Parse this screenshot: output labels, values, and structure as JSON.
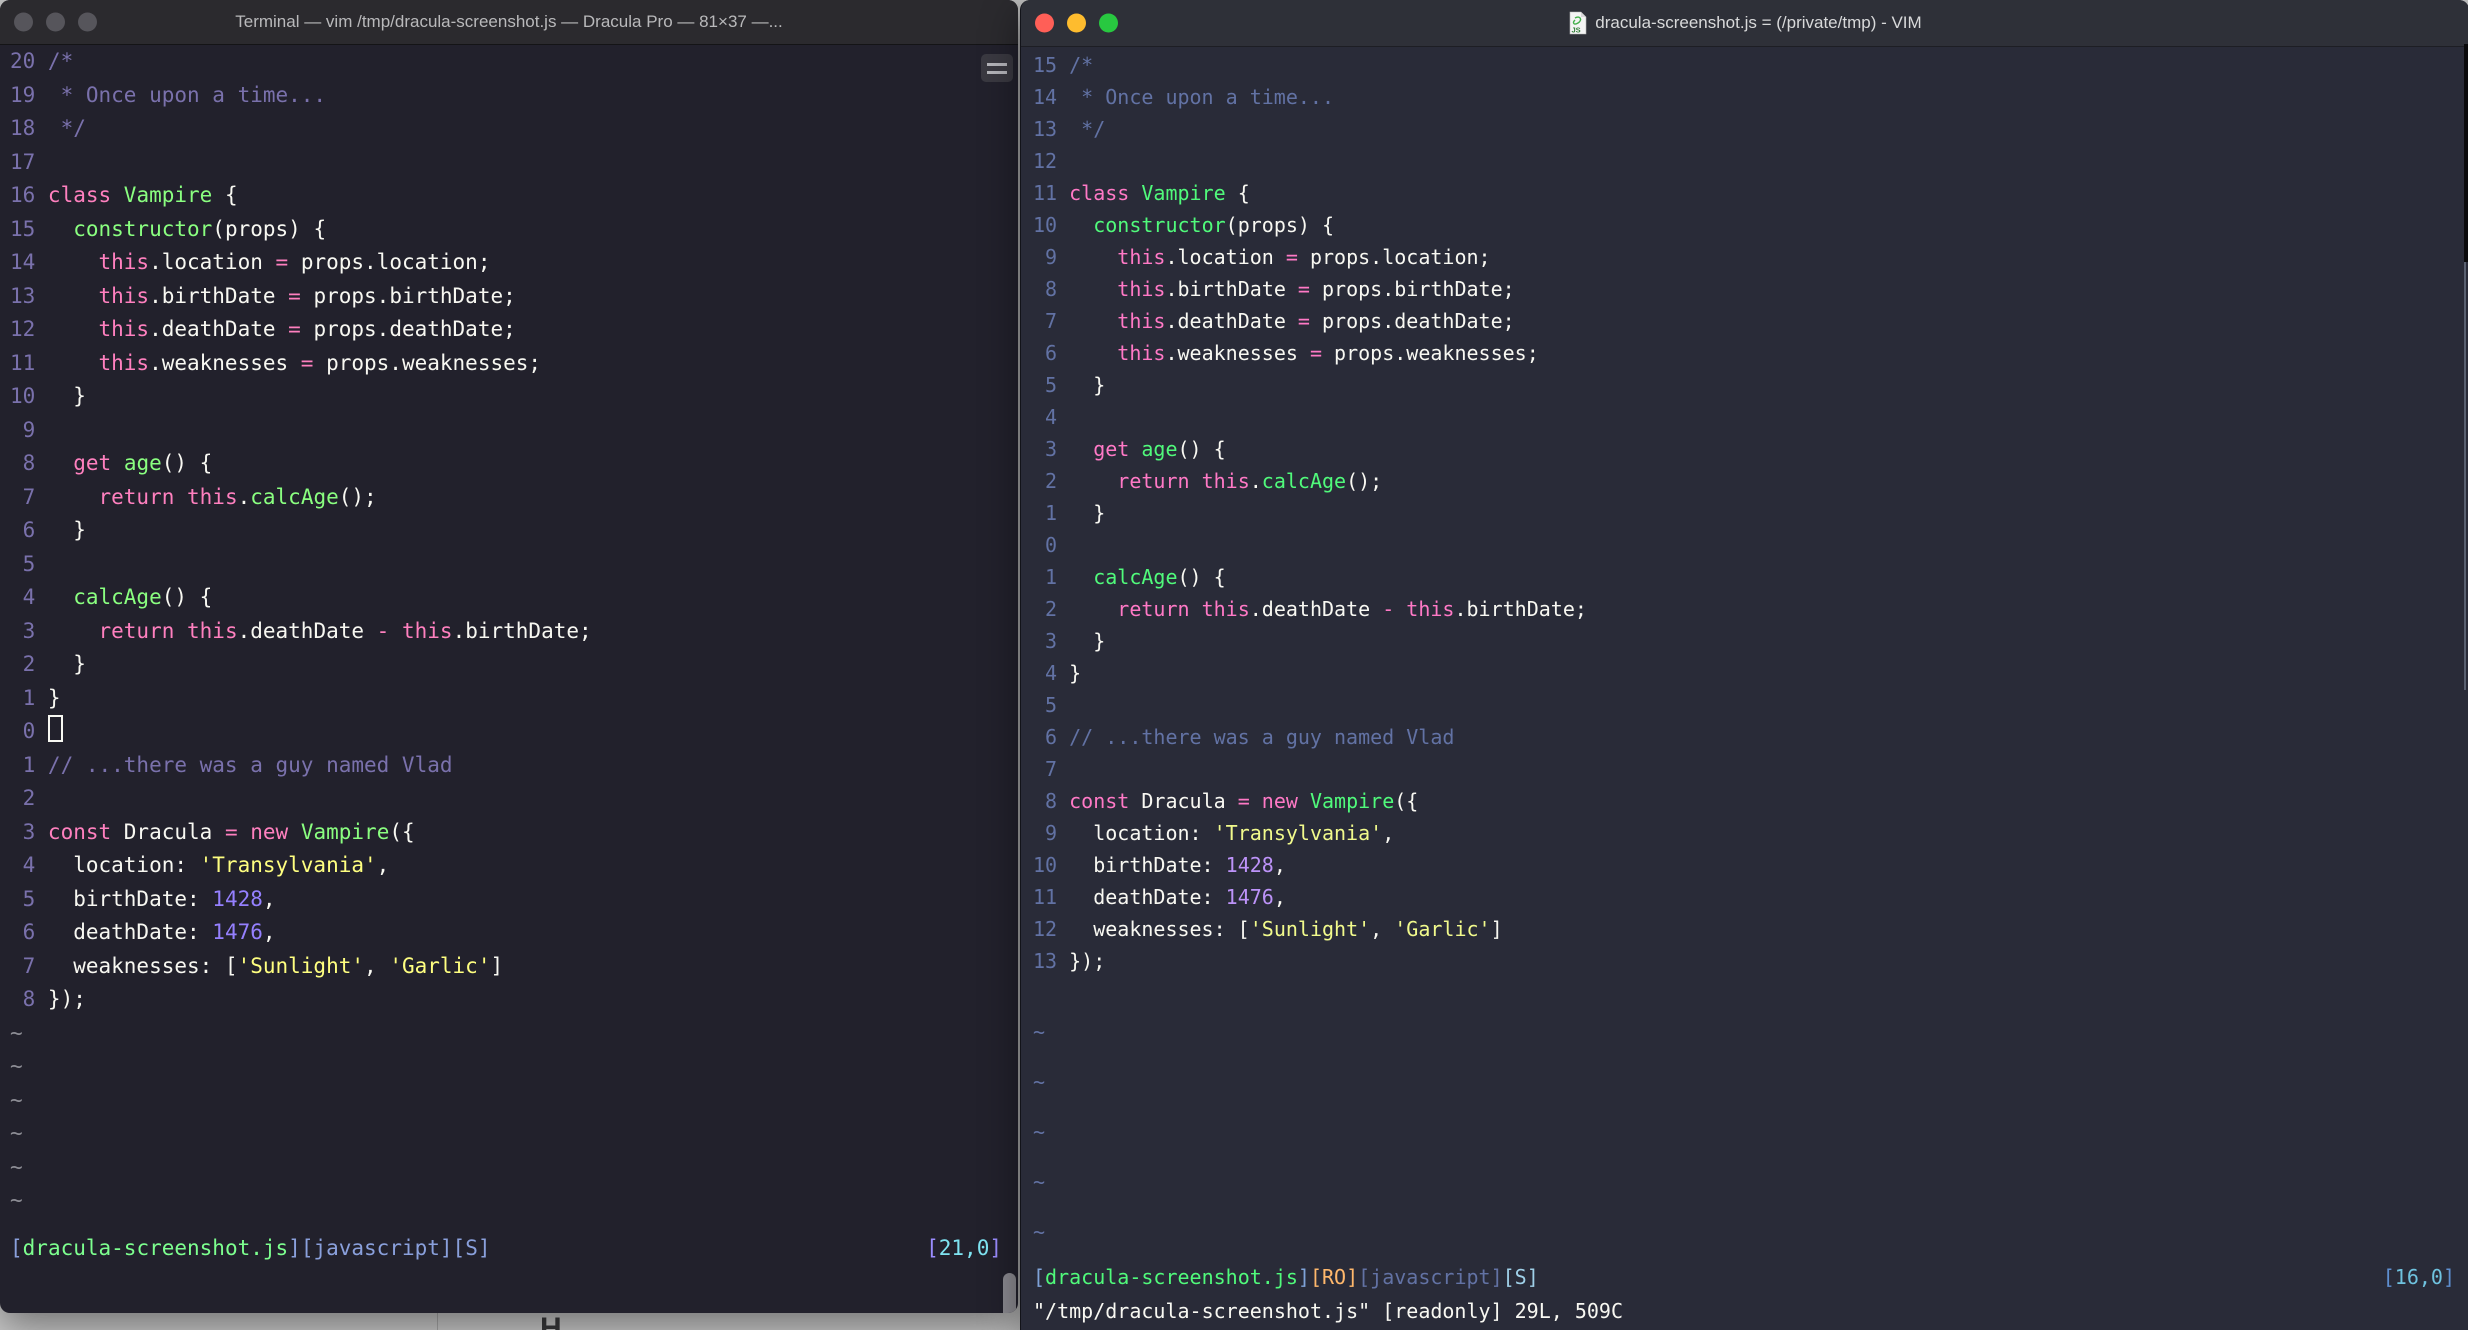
{
  "themes": {
    "left": {
      "bg": "#22212C",
      "titlebar": "#2b2a2e",
      "titlefg": "#b9b9bb",
      "fg": "#F8F8F2",
      "comment": "#7A71AC",
      "keyword": "#FF80BF",
      "func": "#8AFF80",
      "string": "#FFFF80",
      "number": "#9580FF",
      "linenr": "#7A71AC",
      "tilde": "#8d8d95",
      "stBr": "#8aa0dc",
      "stFn": "#7dff8f",
      "stTag": "#8aa0dc",
      "stPosBr": "#9b8cff",
      "stPosNum": "#7fe4f2",
      "trafficInactive": "#56555b"
    },
    "right": {
      "bg": "#292b38",
      "titlebar": "#2e3038",
      "titlefg": "#d8d9da",
      "fg": "#F8F8F2",
      "comment": "#6272A4",
      "keyword": "#FF79C6",
      "func": "#50FA7B",
      "string": "#F1FA8C",
      "number": "#BD93F9",
      "linenr": "#6272A4",
      "tilde": "#6272A4",
      "stBr": "#7fa3d8",
      "stFn": "#50FA7B",
      "stRo": "#FFB86C",
      "stTag": "#6272A4",
      "stS": "#9fd0e8",
      "stPosBr": "#5e8fd0",
      "stPosNum": "#6fc3df",
      "trafficRed": "#FF5F57",
      "trafficYellow": "#FEBC2E",
      "trafficGreen": "#28C840"
    }
  },
  "left_window": {
    "title": "Terminal — vim /tmp/dracula-screenshot.js — Dracula Pro — 81×37 —...",
    "code_lines": [
      {
        "num": "20",
        "segs": [
          [
            "c",
            "/*"
          ]
        ]
      },
      {
        "num": "19",
        "segs": [
          [
            "c",
            " * Once upon a time..."
          ]
        ]
      },
      {
        "num": "18",
        "segs": [
          [
            "c",
            " */"
          ]
        ]
      },
      {
        "num": "17",
        "segs": []
      },
      {
        "num": "16",
        "segs": [
          [
            "k",
            "class"
          ],
          [
            "p",
            " "
          ],
          [
            "f",
            "Vampire"
          ],
          [
            "p",
            " {"
          ]
        ]
      },
      {
        "num": "15",
        "segs": [
          [
            "p",
            "  "
          ],
          [
            "f",
            "constructor"
          ],
          [
            "p",
            "(props) {"
          ]
        ]
      },
      {
        "num": "14",
        "segs": [
          [
            "p",
            "    "
          ],
          [
            "k",
            "this"
          ],
          [
            "p",
            ".location "
          ],
          [
            "k",
            "="
          ],
          [
            "p",
            " props.location;"
          ]
        ]
      },
      {
        "num": "13",
        "segs": [
          [
            "p",
            "    "
          ],
          [
            "k",
            "this"
          ],
          [
            "p",
            ".birthDate "
          ],
          [
            "k",
            "="
          ],
          [
            "p",
            " props.birthDate;"
          ]
        ]
      },
      {
        "num": "12",
        "segs": [
          [
            "p",
            "    "
          ],
          [
            "k",
            "this"
          ],
          [
            "p",
            ".deathDate "
          ],
          [
            "k",
            "="
          ],
          [
            "p",
            " props.deathDate;"
          ]
        ]
      },
      {
        "num": "11",
        "segs": [
          [
            "p",
            "    "
          ],
          [
            "k",
            "this"
          ],
          [
            "p",
            ".weaknesses "
          ],
          [
            "k",
            "="
          ],
          [
            "p",
            " props.weaknesses;"
          ]
        ]
      },
      {
        "num": "10",
        "segs": [
          [
            "p",
            "  }"
          ]
        ]
      },
      {
        "num": "9",
        "segs": []
      },
      {
        "num": "8",
        "segs": [
          [
            "p",
            "  "
          ],
          [
            "k",
            "get"
          ],
          [
            "p",
            " "
          ],
          [
            "f",
            "age"
          ],
          [
            "p",
            "() {"
          ]
        ]
      },
      {
        "num": "7",
        "segs": [
          [
            "p",
            "    "
          ],
          [
            "k",
            "return"
          ],
          [
            "p",
            " "
          ],
          [
            "k",
            "this"
          ],
          [
            "p",
            "."
          ],
          [
            "f",
            "calcAge"
          ],
          [
            "p",
            "();"
          ]
        ]
      },
      {
        "num": "6",
        "segs": [
          [
            "p",
            "  }"
          ]
        ]
      },
      {
        "num": "5",
        "segs": []
      },
      {
        "num": "4",
        "segs": [
          [
            "p",
            "  "
          ],
          [
            "f",
            "calcAge"
          ],
          [
            "p",
            "() {"
          ]
        ]
      },
      {
        "num": "3",
        "segs": [
          [
            "p",
            "    "
          ],
          [
            "k",
            "return"
          ],
          [
            "p",
            " "
          ],
          [
            "k",
            "this"
          ],
          [
            "p",
            ".deathDate "
          ],
          [
            "k",
            "-"
          ],
          [
            "p",
            " "
          ],
          [
            "k",
            "this"
          ],
          [
            "p",
            ".birthDate;"
          ]
        ]
      },
      {
        "num": "2",
        "segs": [
          [
            "p",
            "  }"
          ]
        ]
      },
      {
        "num": "1",
        "segs": [
          [
            "p",
            "}"
          ]
        ]
      },
      {
        "num": "0",
        "segs": [],
        "cursor": true
      },
      {
        "num": "1",
        "segs": [
          [
            "c",
            "// ...there was a guy named Vlad"
          ]
        ]
      },
      {
        "num": "2",
        "segs": []
      },
      {
        "num": "3",
        "segs": [
          [
            "k",
            "const"
          ],
          [
            "p",
            " Dracula "
          ],
          [
            "k",
            "="
          ],
          [
            "p",
            " "
          ],
          [
            "k",
            "new"
          ],
          [
            "p",
            " "
          ],
          [
            "f",
            "Vampire"
          ],
          [
            "p",
            "({"
          ]
        ]
      },
      {
        "num": "4",
        "segs": [
          [
            "p",
            "  location: "
          ],
          [
            "s",
            "'Transylvania'"
          ],
          [
            "p",
            ","
          ]
        ]
      },
      {
        "num": "5",
        "segs": [
          [
            "p",
            "  birthDate: "
          ],
          [
            "n",
            "1428"
          ],
          [
            "p",
            ","
          ]
        ]
      },
      {
        "num": "6",
        "segs": [
          [
            "p",
            "  deathDate: "
          ],
          [
            "n",
            "1476"
          ],
          [
            "p",
            ","
          ]
        ]
      },
      {
        "num": "7",
        "segs": [
          [
            "p",
            "  weaknesses: ["
          ],
          [
            "s",
            "'Sunlight'"
          ],
          [
            "p",
            ", "
          ],
          [
            "s",
            "'Garlic'"
          ],
          [
            "p",
            "]"
          ]
        ]
      },
      {
        "num": "8",
        "segs": [
          [
            "p",
            "});"
          ]
        ]
      }
    ],
    "tilde_count": 6,
    "status_left": [
      [
        "sb",
        "["
      ],
      [
        "sf",
        "dracula-screenshot.js"
      ],
      [
        "sb",
        "]"
      ],
      [
        "st",
        "[javascript]"
      ],
      [
        "st",
        "[S]"
      ]
    ],
    "status_right": [
      [
        "pb",
        "["
      ],
      [
        "pn",
        "21,0"
      ],
      [
        "pb",
        "]"
      ]
    ]
  },
  "right_window": {
    "title": "dracula-screenshot.js = (/private/tmp) - VIM",
    "doc_icon_label": "JS",
    "code_lines": [
      {
        "num": "15",
        "segs": [
          [
            "c",
            "/*"
          ]
        ]
      },
      {
        "num": "14",
        "segs": [
          [
            "c",
            " * Once upon a time..."
          ]
        ]
      },
      {
        "num": "13",
        "segs": [
          [
            "c",
            " */"
          ]
        ]
      },
      {
        "num": "12",
        "segs": []
      },
      {
        "num": "11",
        "segs": [
          [
            "k",
            "class"
          ],
          [
            "p",
            " "
          ],
          [
            "f",
            "Vampire"
          ],
          [
            "p",
            " {"
          ]
        ]
      },
      {
        "num": "10",
        "segs": [
          [
            "p",
            "  "
          ],
          [
            "f",
            "constructor"
          ],
          [
            "p",
            "(props) {"
          ]
        ]
      },
      {
        "num": "9",
        "segs": [
          [
            "p",
            "    "
          ],
          [
            "k",
            "this"
          ],
          [
            "p",
            ".location "
          ],
          [
            "k",
            "="
          ],
          [
            "p",
            " props.location;"
          ]
        ]
      },
      {
        "num": "8",
        "segs": [
          [
            "p",
            "    "
          ],
          [
            "k",
            "this"
          ],
          [
            "p",
            ".birthDate "
          ],
          [
            "k",
            "="
          ],
          [
            "p",
            " props.birthDate;"
          ]
        ]
      },
      {
        "num": "7",
        "segs": [
          [
            "p",
            "    "
          ],
          [
            "k",
            "this"
          ],
          [
            "p",
            ".deathDate "
          ],
          [
            "k",
            "="
          ],
          [
            "p",
            " props.deathDate;"
          ]
        ]
      },
      {
        "num": "6",
        "segs": [
          [
            "p",
            "    "
          ],
          [
            "k",
            "this"
          ],
          [
            "p",
            ".weaknesses "
          ],
          [
            "k",
            "="
          ],
          [
            "p",
            " props.weaknesses;"
          ]
        ]
      },
      {
        "num": "5",
        "segs": [
          [
            "p",
            "  }"
          ]
        ]
      },
      {
        "num": "4",
        "segs": []
      },
      {
        "num": "3",
        "segs": [
          [
            "p",
            "  "
          ],
          [
            "k",
            "get"
          ],
          [
            "p",
            " "
          ],
          [
            "f",
            "age"
          ],
          [
            "p",
            "() {"
          ]
        ]
      },
      {
        "num": "2",
        "segs": [
          [
            "p",
            "    "
          ],
          [
            "k",
            "return"
          ],
          [
            "p",
            " "
          ],
          [
            "k",
            "this"
          ],
          [
            "p",
            "."
          ],
          [
            "f",
            "calcAge"
          ],
          [
            "p",
            "();"
          ]
        ]
      },
      {
        "num": "1",
        "segs": [
          [
            "p",
            "  }"
          ]
        ]
      },
      {
        "num": "0",
        "segs": []
      },
      {
        "num": "1",
        "segs": [
          [
            "p",
            "  "
          ],
          [
            "f",
            "calcAge"
          ],
          [
            "p",
            "() {"
          ]
        ]
      },
      {
        "num": "2",
        "segs": [
          [
            "p",
            "    "
          ],
          [
            "k",
            "return"
          ],
          [
            "p",
            " "
          ],
          [
            "k",
            "this"
          ],
          [
            "p",
            ".deathDate "
          ],
          [
            "k",
            "-"
          ],
          [
            "p",
            " "
          ],
          [
            "k",
            "this"
          ],
          [
            "p",
            ".birthDate;"
          ]
        ]
      },
      {
        "num": "3",
        "segs": [
          [
            "p",
            "  }"
          ]
        ]
      },
      {
        "num": "4",
        "segs": [
          [
            "p",
            "}"
          ]
        ]
      },
      {
        "num": "5",
        "segs": []
      },
      {
        "num": "6",
        "segs": [
          [
            "c",
            "// ...there was a guy named Vlad"
          ]
        ]
      },
      {
        "num": "7",
        "segs": []
      },
      {
        "num": "8",
        "segs": [
          [
            "k",
            "const"
          ],
          [
            "p",
            " Dracula "
          ],
          [
            "k",
            "="
          ],
          [
            "p",
            " "
          ],
          [
            "k",
            "new"
          ],
          [
            "p",
            " "
          ],
          [
            "f",
            "Vampire"
          ],
          [
            "p",
            "({"
          ]
        ]
      },
      {
        "num": "9",
        "segs": [
          [
            "p",
            "  location: "
          ],
          [
            "s",
            "'Transylvania'"
          ],
          [
            "p",
            ","
          ]
        ]
      },
      {
        "num": "10",
        "segs": [
          [
            "p",
            "  birthDate: "
          ],
          [
            "n",
            "1428"
          ],
          [
            "p",
            ","
          ]
        ]
      },
      {
        "num": "11",
        "segs": [
          [
            "p",
            "  deathDate: "
          ],
          [
            "n",
            "1476"
          ],
          [
            "p",
            ","
          ]
        ]
      },
      {
        "num": "12",
        "segs": [
          [
            "p",
            "  weaknesses: ["
          ],
          [
            "s",
            "'Sunlight'"
          ],
          [
            "p",
            ", "
          ],
          [
            "s",
            "'Garlic'"
          ],
          [
            "p",
            "]"
          ]
        ]
      },
      {
        "num": "13",
        "segs": [
          [
            "p",
            "});"
          ]
        ]
      }
    ],
    "tilde_count": 5,
    "status_left": [
      [
        "sb",
        "["
      ],
      [
        "sf",
        "dracula-screenshot.js"
      ],
      [
        "sb",
        "]"
      ],
      [
        "sr",
        "[RO]"
      ],
      [
        "st",
        "[javascript]"
      ],
      [
        "ss",
        "[S]"
      ]
    ],
    "status_right": [
      [
        "pb",
        "["
      ],
      [
        "pn",
        "16,0"
      ],
      [
        "pb",
        "]"
      ]
    ],
    "status2": "\"/tmp/dracula-screenshot.js\" [readonly] 29L, 509C"
  },
  "background": {
    "partial_glyph": "H"
  }
}
